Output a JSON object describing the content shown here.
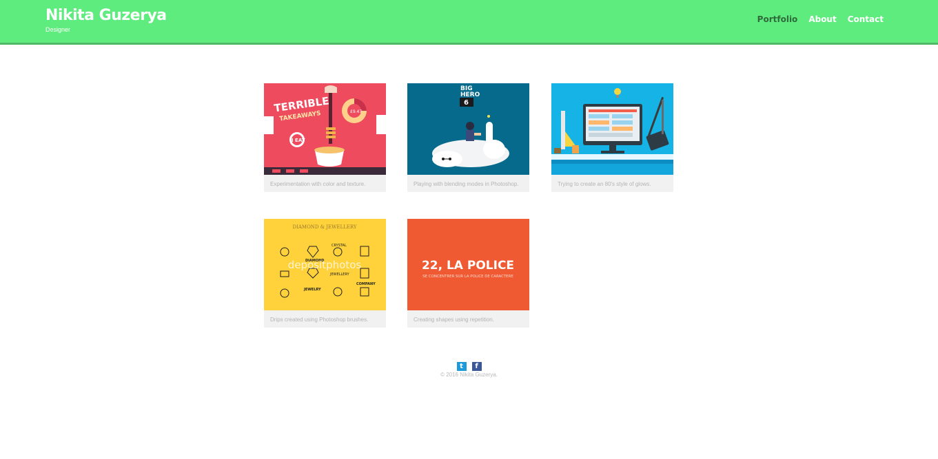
{
  "header": {
    "title": "Nikita Guzerya",
    "subtitle": "Designer",
    "nav": [
      {
        "label": "Portfolio",
        "active": true
      },
      {
        "label": "About",
        "active": false
      },
      {
        "label": "Contact",
        "active": false
      }
    ]
  },
  "portfolio": [
    {
      "caption": "Experimentation with color and texture.",
      "art_text": [
        "TERRIBLE",
        "TAKEAWAYS",
        "£9.47",
        "I EAT"
      ]
    },
    {
      "caption": "Playing with blending modes in Photoshop.",
      "art_text": [
        "BIG",
        "HERO",
        "6"
      ]
    },
    {
      "caption": "Trying to create an 80's style of glows.",
      "art_text": []
    },
    {
      "caption": "Drips created using Photoshop brushes.",
      "art_text": [
        "DIAMOND & JEWELLERY",
        "depositphotos",
        "DIAMOND",
        "CRYSTAL",
        "JEWELRY",
        "JEWELLERY",
        "COMPANY"
      ]
    },
    {
      "caption": "Creating shapes using repetition.",
      "art_text": [
        "22, LA POLICE",
        "SE CONCENTRER SUR LA POLICE DE CARACTERE"
      ]
    }
  ],
  "footer": {
    "social": [
      {
        "icon": "twitter-icon",
        "glyph": "t"
      },
      {
        "icon": "facebook-icon",
        "glyph": "f"
      }
    ],
    "copyright": "© 2016 Nikita Guzerya."
  },
  "colors": {
    "header": "#5fec7e",
    "nav_active": "#2f6a3c",
    "card1": "#ef4b5f",
    "card2": "#066a8c",
    "card3": "#16b3e6",
    "card4": "#ffd23c",
    "card5": "#f05a33"
  }
}
